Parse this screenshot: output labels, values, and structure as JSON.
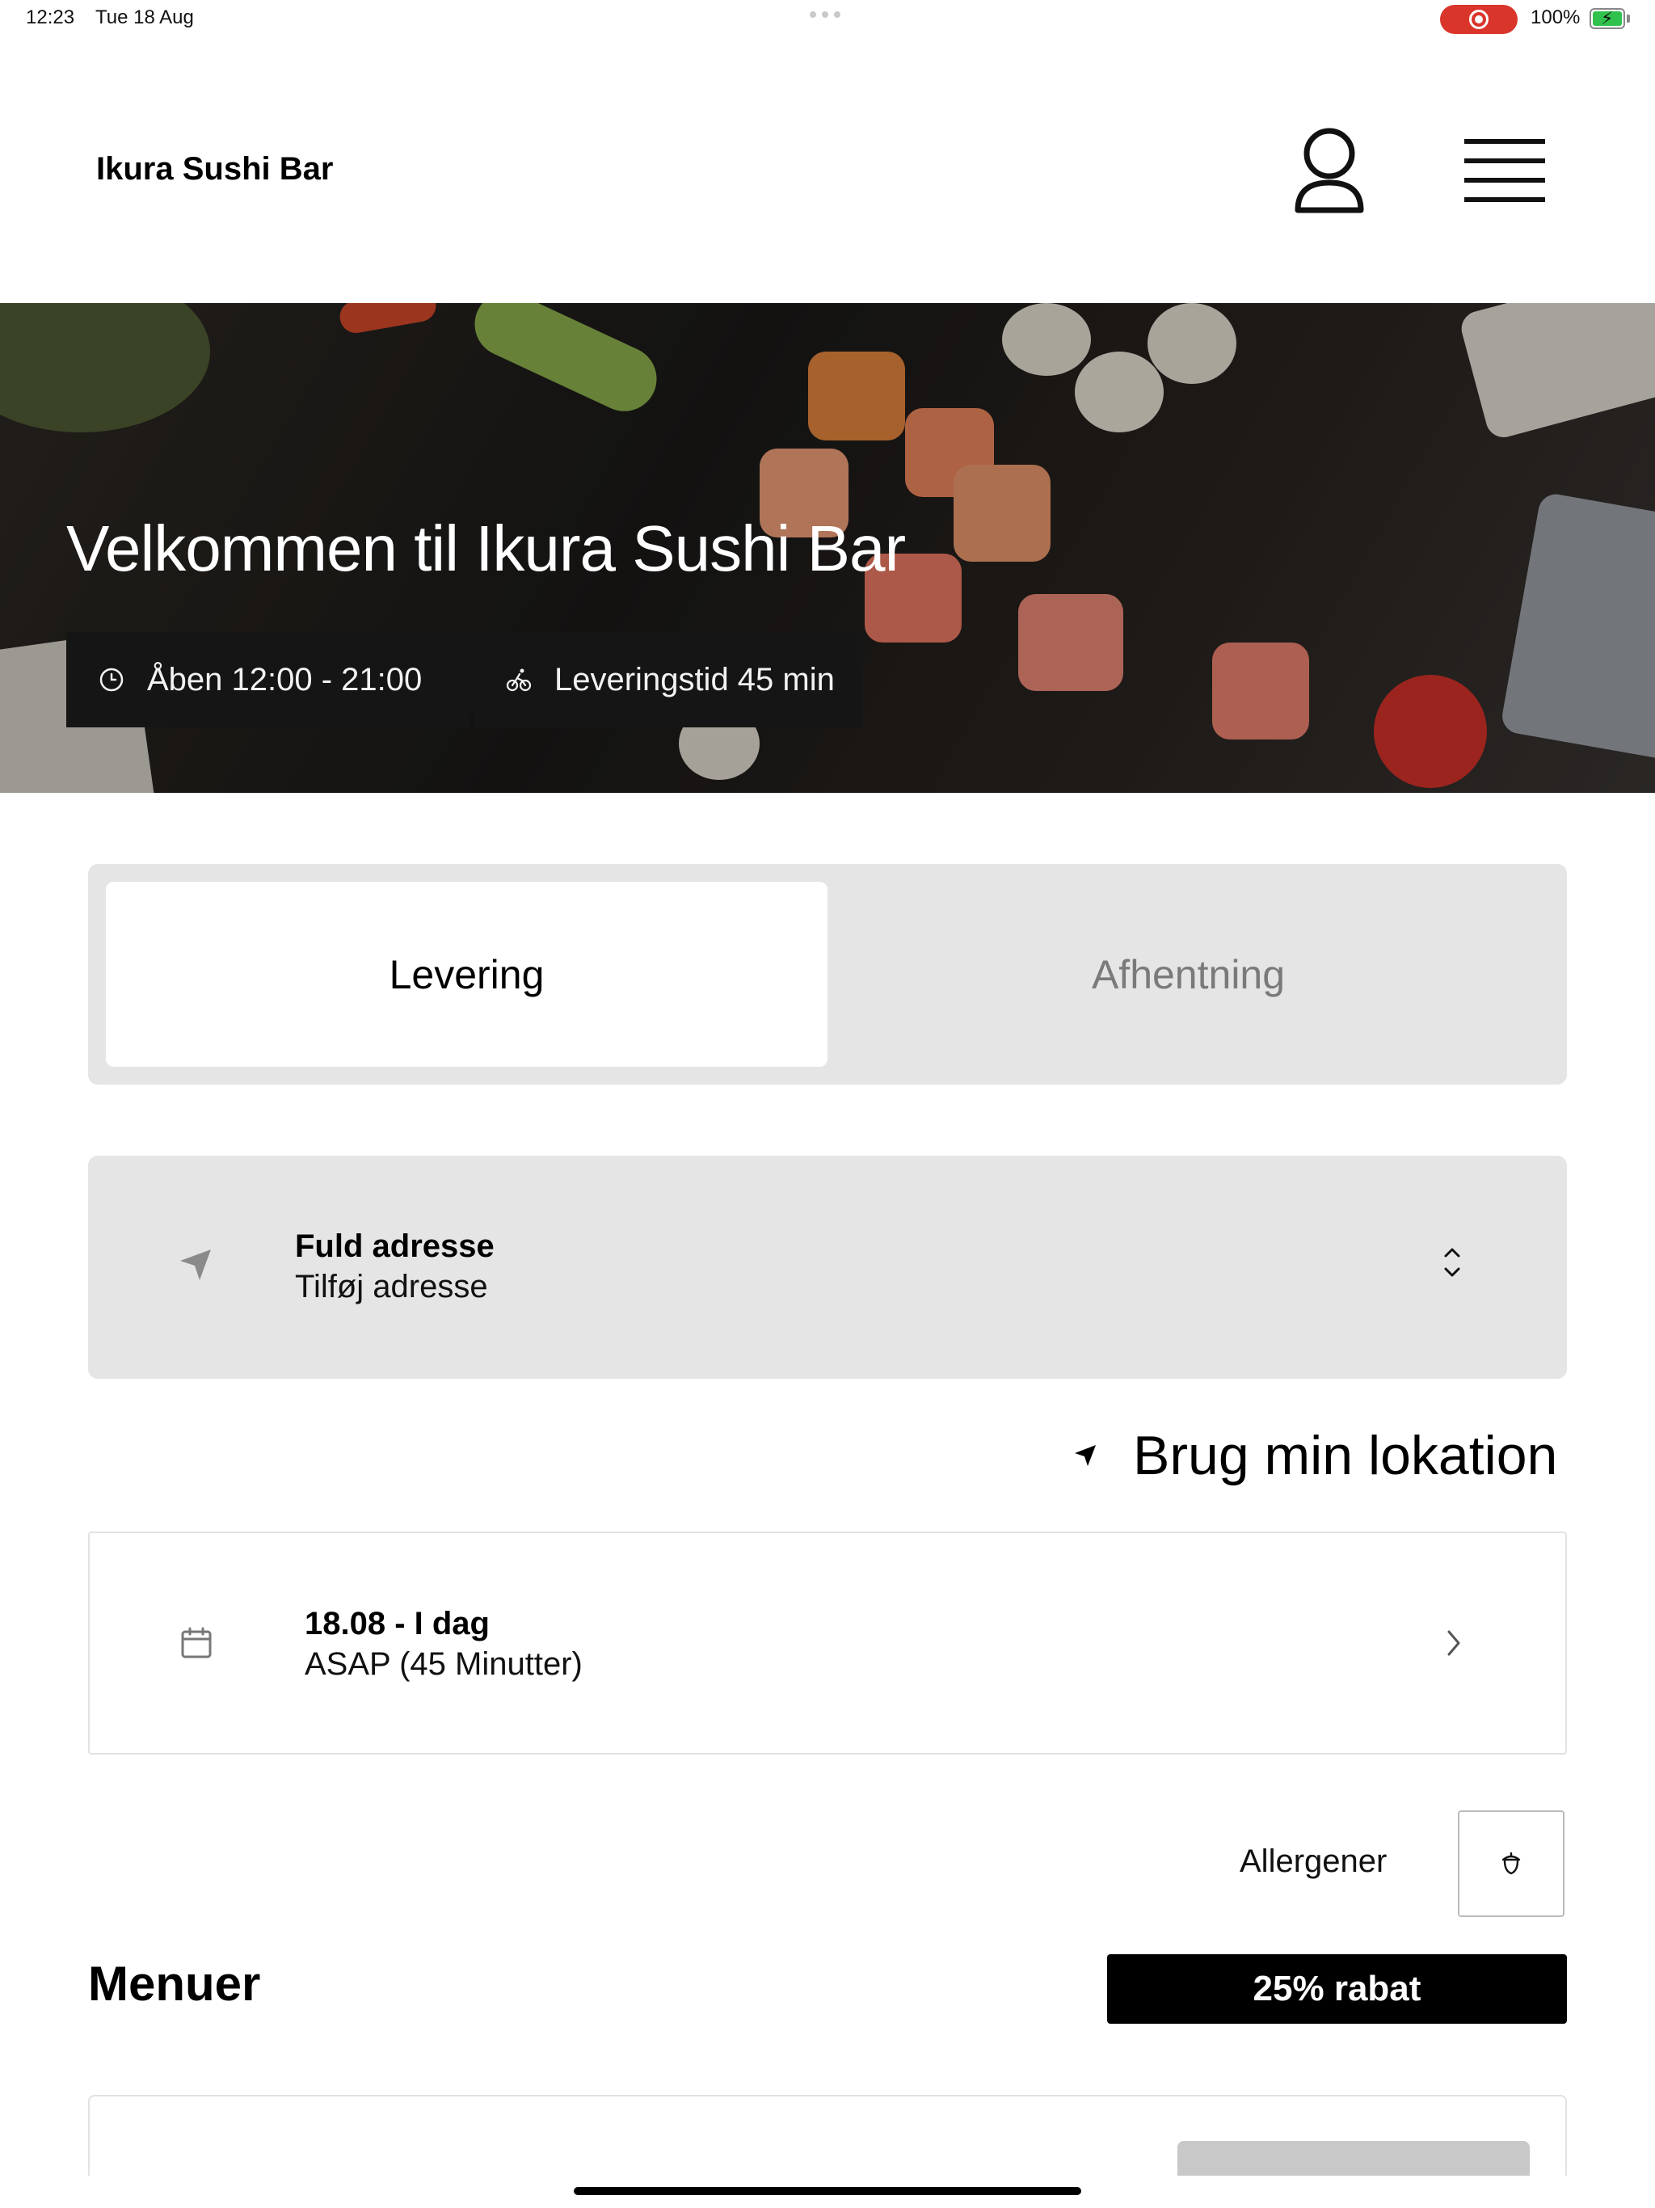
{
  "status_bar": {
    "time": "12:23",
    "date": "Tue 18 Aug",
    "battery_percent": "100%",
    "recording_color": "#d9352b",
    "battery_color": "#31c24d"
  },
  "header": {
    "brand": "Ikura Sushi Bar",
    "profile_icon": "person-icon",
    "menu_icon": "hamburger-icon"
  },
  "hero": {
    "title": "Velkommen til Ikura Sushi Bar",
    "open_hours": "Åben 12:00 - 21:00",
    "delivery_time": "Leveringstid 45 min",
    "open_icon": "clock-icon",
    "delivery_icon": "bicycle-icon"
  },
  "order_mode": {
    "options": [
      "Levering",
      "Afhentning"
    ],
    "selected": "Levering"
  },
  "address": {
    "title": "Fuld adresse",
    "value": "Tilføj adresse",
    "icon": "location-arrow-icon"
  },
  "use_location": {
    "label": "Brug min lokation",
    "icon": "location-arrow-icon"
  },
  "schedule": {
    "date": "18.08 - I dag",
    "time": "ASAP (45 Minutter)",
    "icon": "calendar-icon"
  },
  "allergens": {
    "label": "Allergener",
    "icon": "acorn-icon"
  },
  "menus": {
    "title": "Menuer",
    "discount": "25% rabat"
  }
}
